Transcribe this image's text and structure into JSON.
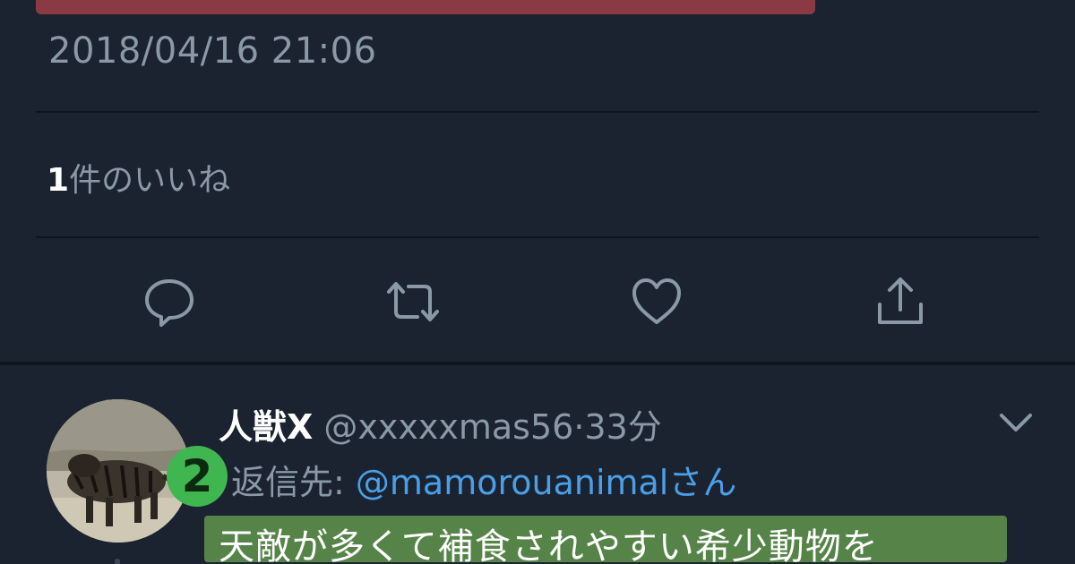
{
  "tweet": {
    "timestamp": "2018/04/16 21:06",
    "likes_count": "1",
    "likes_label": "件のいいね"
  },
  "actions": {
    "reply_icon": "reply-icon",
    "retweet_icon": "retweet-icon",
    "like_icon": "heart-icon",
    "share_icon": "share-icon"
  },
  "reply": {
    "display_name": "人獣X",
    "handle": "@xxxxxmas56",
    "separator": "·",
    "time_ago": "33分",
    "reply_to_label": "返信先: ",
    "reply_to_mention": "@mamorouanimal",
    "reply_to_suffix": "さん",
    "annotation_number": "2",
    "text": "天敵が多くて補食されやすい希少動物を"
  },
  "colors": {
    "background": "#1b2331",
    "muted_text": "#8b98a5",
    "link": "#4a9fe6",
    "red_marker": "#8b3a44",
    "green_marker": "#5a8a4a",
    "badge_green": "#3fb650"
  }
}
